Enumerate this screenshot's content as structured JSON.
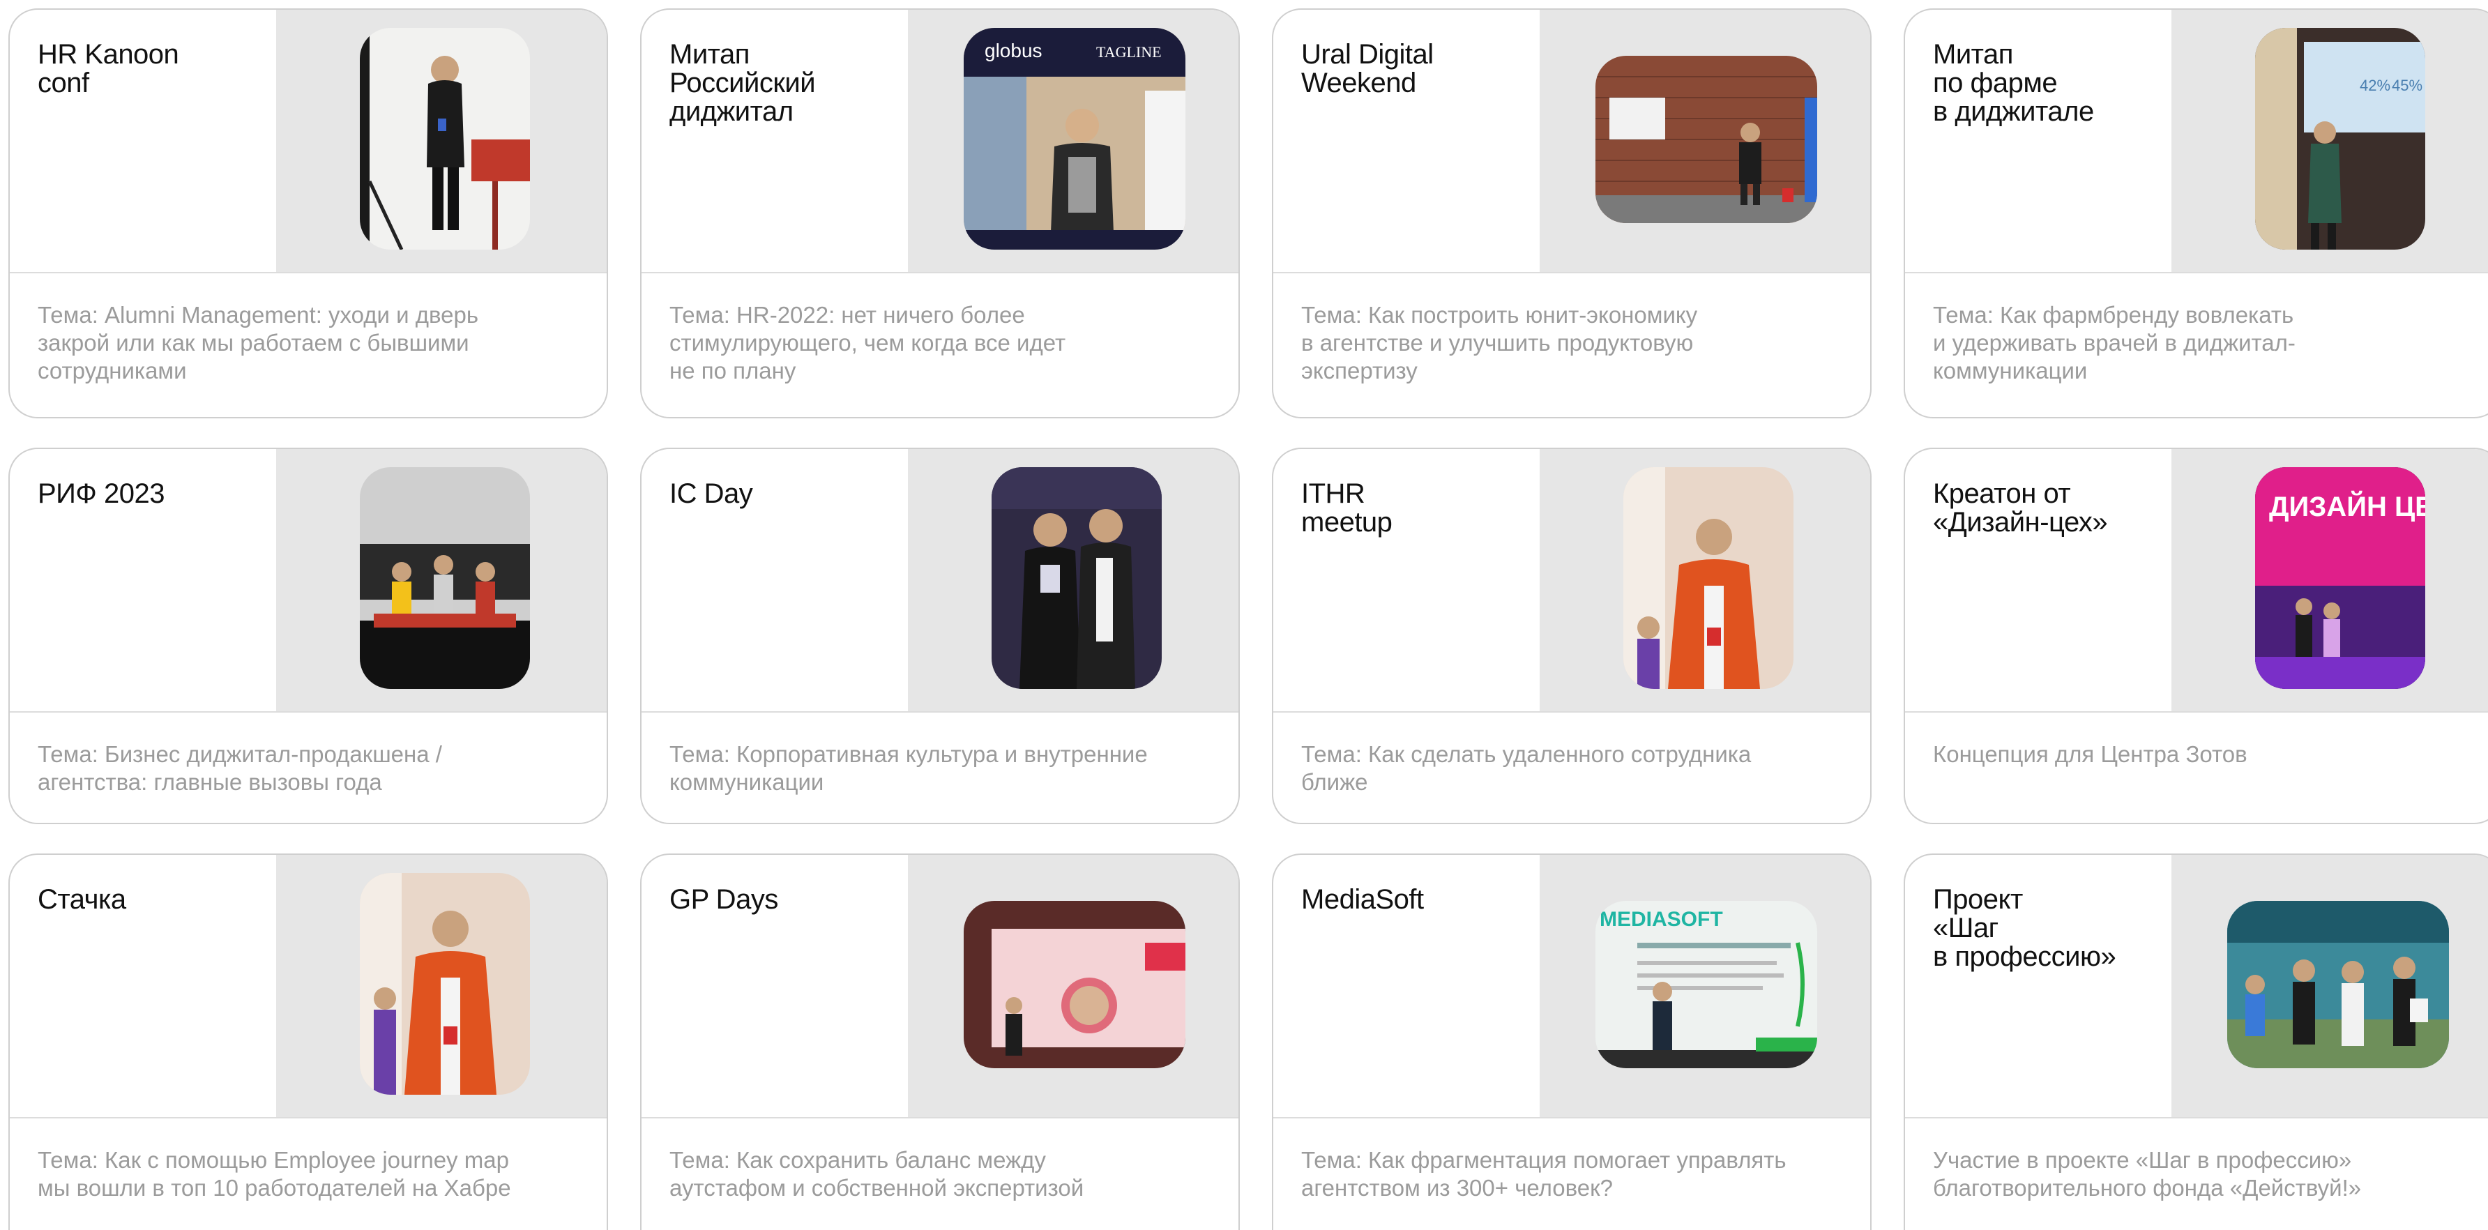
{
  "cards": [
    {
      "title": "HR Kanoon\nconf",
      "desc": "Тема: Alumni Management: уходи и дверь\nзакрой или как мы работаем с бывшими\nсотрудниками",
      "photo_icon": "speaker-with-mic-photo"
    },
    {
      "title": "Митап\nРоссийский\nдиджитал",
      "desc": "Тема:  HR-2022: нет ничего более\nстимулирующего, чем когда все идет\nне по плану",
      "photo_icon": "speaker-with-mic-photo",
      "photo_logos": [
        "globus",
        "TAGLINE"
      ]
    },
    {
      "title": "Ural Digital\nWeekend",
      "desc": "Тема: Как построить юнит-экономику\nв агентстве и улучшить продуктовую\nэкспертизу",
      "photo_icon": "speaker-at-brick-wall-photo"
    },
    {
      "title": "Митап\nпо фарме\nв диджитале",
      "desc": "Тема: Как фармбренду вовлекать\nи удерживать врачей в диджитал-\nкоммуникации",
      "photo_icon": "speaker-at-screen-photo"
    },
    {
      "title": "РИФ 2023",
      "desc": "Тема: Бизнес диджитал-продакшена /\nагентства: главные вызовы года",
      "photo_icon": "panel-discussion-photo"
    },
    {
      "title": "IC Day",
      "desc": "Тема: Корпоративная культура и внутренние\nкоммуникации",
      "photo_icon": "two-women-photo"
    },
    {
      "title": "ITHR\nmeetup",
      "desc": "Тема: Как сделать удаленного сотрудника\nближе",
      "photo_icon": "speaker-orange-jacket-photo"
    },
    {
      "title": "Креатон от\n«Дизайн-цех»",
      "desc": "Концепция для Центра Зотов",
      "photo_icon": "design-event-stage-photo",
      "photo_text": "ДИЗАЙН ЦЕХ"
    },
    {
      "title": "Стачка",
      "desc": "Тема: Как с помощью Employee journey map\nмы вошли в топ 10 работодателей на Хабре",
      "photo_icon": "speaker-orange-jacket-photo"
    },
    {
      "title": "GP Days",
      "desc": "Тема: Как сохранить баланс между\nаутстафом и собственной экспертизой",
      "photo_icon": "speaker-at-pink-screen-photo"
    },
    {
      "title": "MediaSoft",
      "desc": "Тема: Как фрагментация помогает управлять\nагентством из 300+ человек?",
      "photo_icon": "mediasoft-conference-photo",
      "photo_text": "MEDIASOFT"
    },
    {
      "title": "Проект\n«Шаг\nв профессию»",
      "desc": "Участие в проекте «Шаг в профессию»\nблаготворительного фонда «Действуй!»",
      "photo_icon": "award-ceremony-photo"
    }
  ],
  "colors": {
    "title": "#111111",
    "description": "#9b9b9b",
    "photo_panel": "#e6e6e6",
    "border": "#cfcfcf"
  }
}
